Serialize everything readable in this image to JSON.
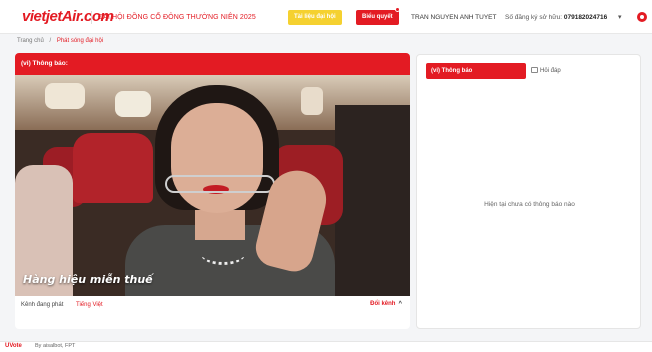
{
  "header": {
    "logo_text": "vietjetAir.com",
    "meeting_title": "ĐẠI HỘI ĐỒNG CỔ ĐÔNG THƯỜNG NIÊN 2025",
    "docs_button": "Tài liệu đại hội",
    "vote_button": "Biểu quyết",
    "user_name": "TRAN NGUYEN ANH TUYET",
    "share_label": "Số đăng ký sở hữu:",
    "share_number": "079182024716"
  },
  "breadcrumb": {
    "home": "Trang chủ",
    "separator": "/",
    "current": "Phát sóng đại hội"
  },
  "video": {
    "header_label": "(vi) Thông báo:",
    "caption": "Hàng hiệu miễn thuế"
  },
  "channel": {
    "label": "Kênh đang phát",
    "value": "Tiếng Việt",
    "switch_label": "Đổi kênh"
  },
  "side_panel": {
    "tab_notifications": "(vi) Thông báo",
    "tab_qa": "Hỏi đáp",
    "empty_message": "Hiện tại chưa có thông báo nào"
  },
  "footer": {
    "logo": "UVote",
    "by_text": "By aisalbot, FPT"
  },
  "colors": {
    "brand_red": "#e31b23",
    "docs_yellow": "#f5d130"
  }
}
